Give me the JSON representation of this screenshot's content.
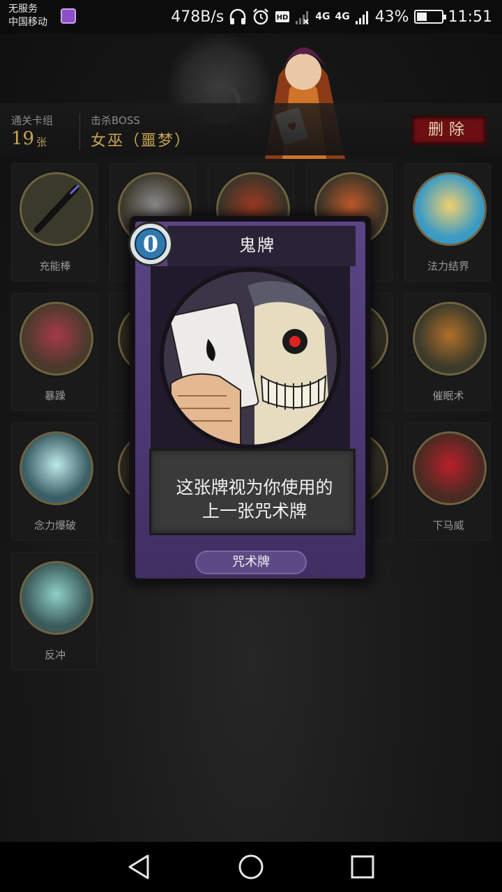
{
  "status_bar": {
    "carrier_line1": "无服务",
    "carrier_line2": "中国移动",
    "speed": "478B/s",
    "network_a": "4G",
    "network_b": "4G",
    "battery": "43%",
    "battery_level": 0.43,
    "time": "11:51"
  },
  "header": {
    "deck_label": "通关卡组",
    "deck_count": "19",
    "deck_unit": "张",
    "boss_label": "击杀BOSS",
    "boss_name": "女巫（噩梦）",
    "delete_label": "删除"
  },
  "grid": {
    "tiles": [
      {
        "label": "充能棒",
        "icon": "wand-icon"
      },
      {
        "label": "",
        "icon": "sword-fighter-icon"
      },
      {
        "label": "",
        "icon": "hooded-rogue-icon"
      },
      {
        "label": "",
        "icon": "goblin-icon"
      },
      {
        "label": "法力结界",
        "icon": "mana-barrier-icon"
      },
      {
        "label": "暴躁",
        "icon": "rage-brute-icon"
      },
      {
        "label": "",
        "icon": "hidden-card-icon"
      },
      {
        "label": "",
        "icon": "hidden-card-icon"
      },
      {
        "label": "",
        "icon": "hidden-card-icon"
      },
      {
        "label": "催眠术",
        "icon": "hypnosis-icon"
      },
      {
        "label": "念力爆破",
        "icon": "psychic-blast-icon"
      },
      {
        "label": "",
        "icon": "hidden-card-icon"
      },
      {
        "label": "",
        "icon": "hidden-card-icon"
      },
      {
        "label": "",
        "icon": "hidden-card-icon"
      },
      {
        "label": "下马威",
        "icon": "intimidate-icon"
      },
      {
        "label": "反冲",
        "icon": "recoil-icon"
      }
    ]
  },
  "card": {
    "cost": "0",
    "name": "鬼牌",
    "description_line1": "这张牌视为你使用的",
    "description_line2": "上一张咒术牌",
    "type": "咒术牌",
    "art": "skull-joker-icon"
  },
  "colors": {
    "accent_gold": "#c9a552",
    "delete_red": "#6b0f12",
    "card_purple": "#5b4585",
    "cost_blue": "#2f77ad"
  },
  "nav": {
    "back": "back-icon",
    "home": "home-icon",
    "recents": "recents-icon"
  }
}
